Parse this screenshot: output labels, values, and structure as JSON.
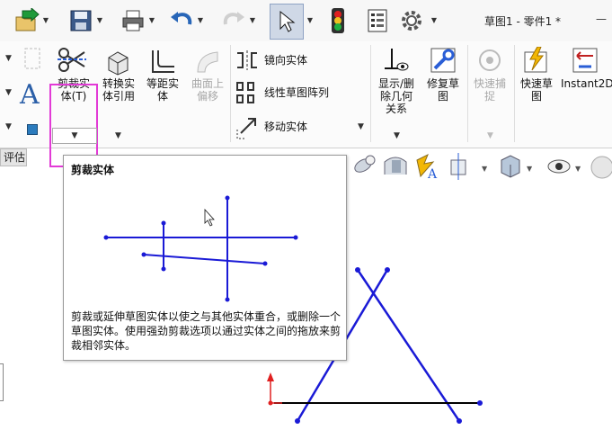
{
  "window": {
    "title": "草图1 - 零件1 *",
    "minimize_glyph": "—"
  },
  "quick_access": {
    "items": [
      "new-arrow-icon",
      "save-icon",
      "print-icon",
      "undo-icon",
      "redo-icon",
      "select-icon",
      "rebuild-icon",
      "file-properties-icon",
      "options-icon"
    ]
  },
  "ribbon": {
    "trim": {
      "label_line1": "剪裁实",
      "label_line2": "体(T)"
    },
    "convert": {
      "label_line1": "转换实",
      "label_line2": "体引用"
    },
    "offset": {
      "label_line1": "等距实",
      "label_line2": "体"
    },
    "offset_surface": {
      "label_line1": "曲面上",
      "label_line2": "偏移"
    },
    "mirror": {
      "label": "镜向实体"
    },
    "linear_pattern": {
      "label": "线性草图阵列"
    },
    "move": {
      "label": "移动实体"
    },
    "display_relations": {
      "label_line1": "显示/删",
      "label_line2": "除几何",
      "label_line3": "关系"
    },
    "repair_sketch": {
      "label_line1": "修复草",
      "label_line2": "图"
    },
    "quick_snaps": {
      "label_line1": "快速捕",
      "label_line2": "捉"
    },
    "rapid_sketch": {
      "label_line1": "快速草",
      "label_line2": "图"
    },
    "instant2d": {
      "label": "Instant2D"
    }
  },
  "tab_fragment": {
    "label": "评估"
  },
  "tooltip": {
    "title": "剪裁实体",
    "description": "剪裁或延伸草图实体以使之与其他实体重合，或删除一个草图实体。使用强劲剪裁选项以通过实体之间的拖放来剪裁相邻实体。"
  },
  "colors": {
    "accent_highlight": "#e23ad6",
    "sketch_line": "#1a1ad6",
    "sketch_fixed": "#000000",
    "origin_red": "#e02020"
  }
}
